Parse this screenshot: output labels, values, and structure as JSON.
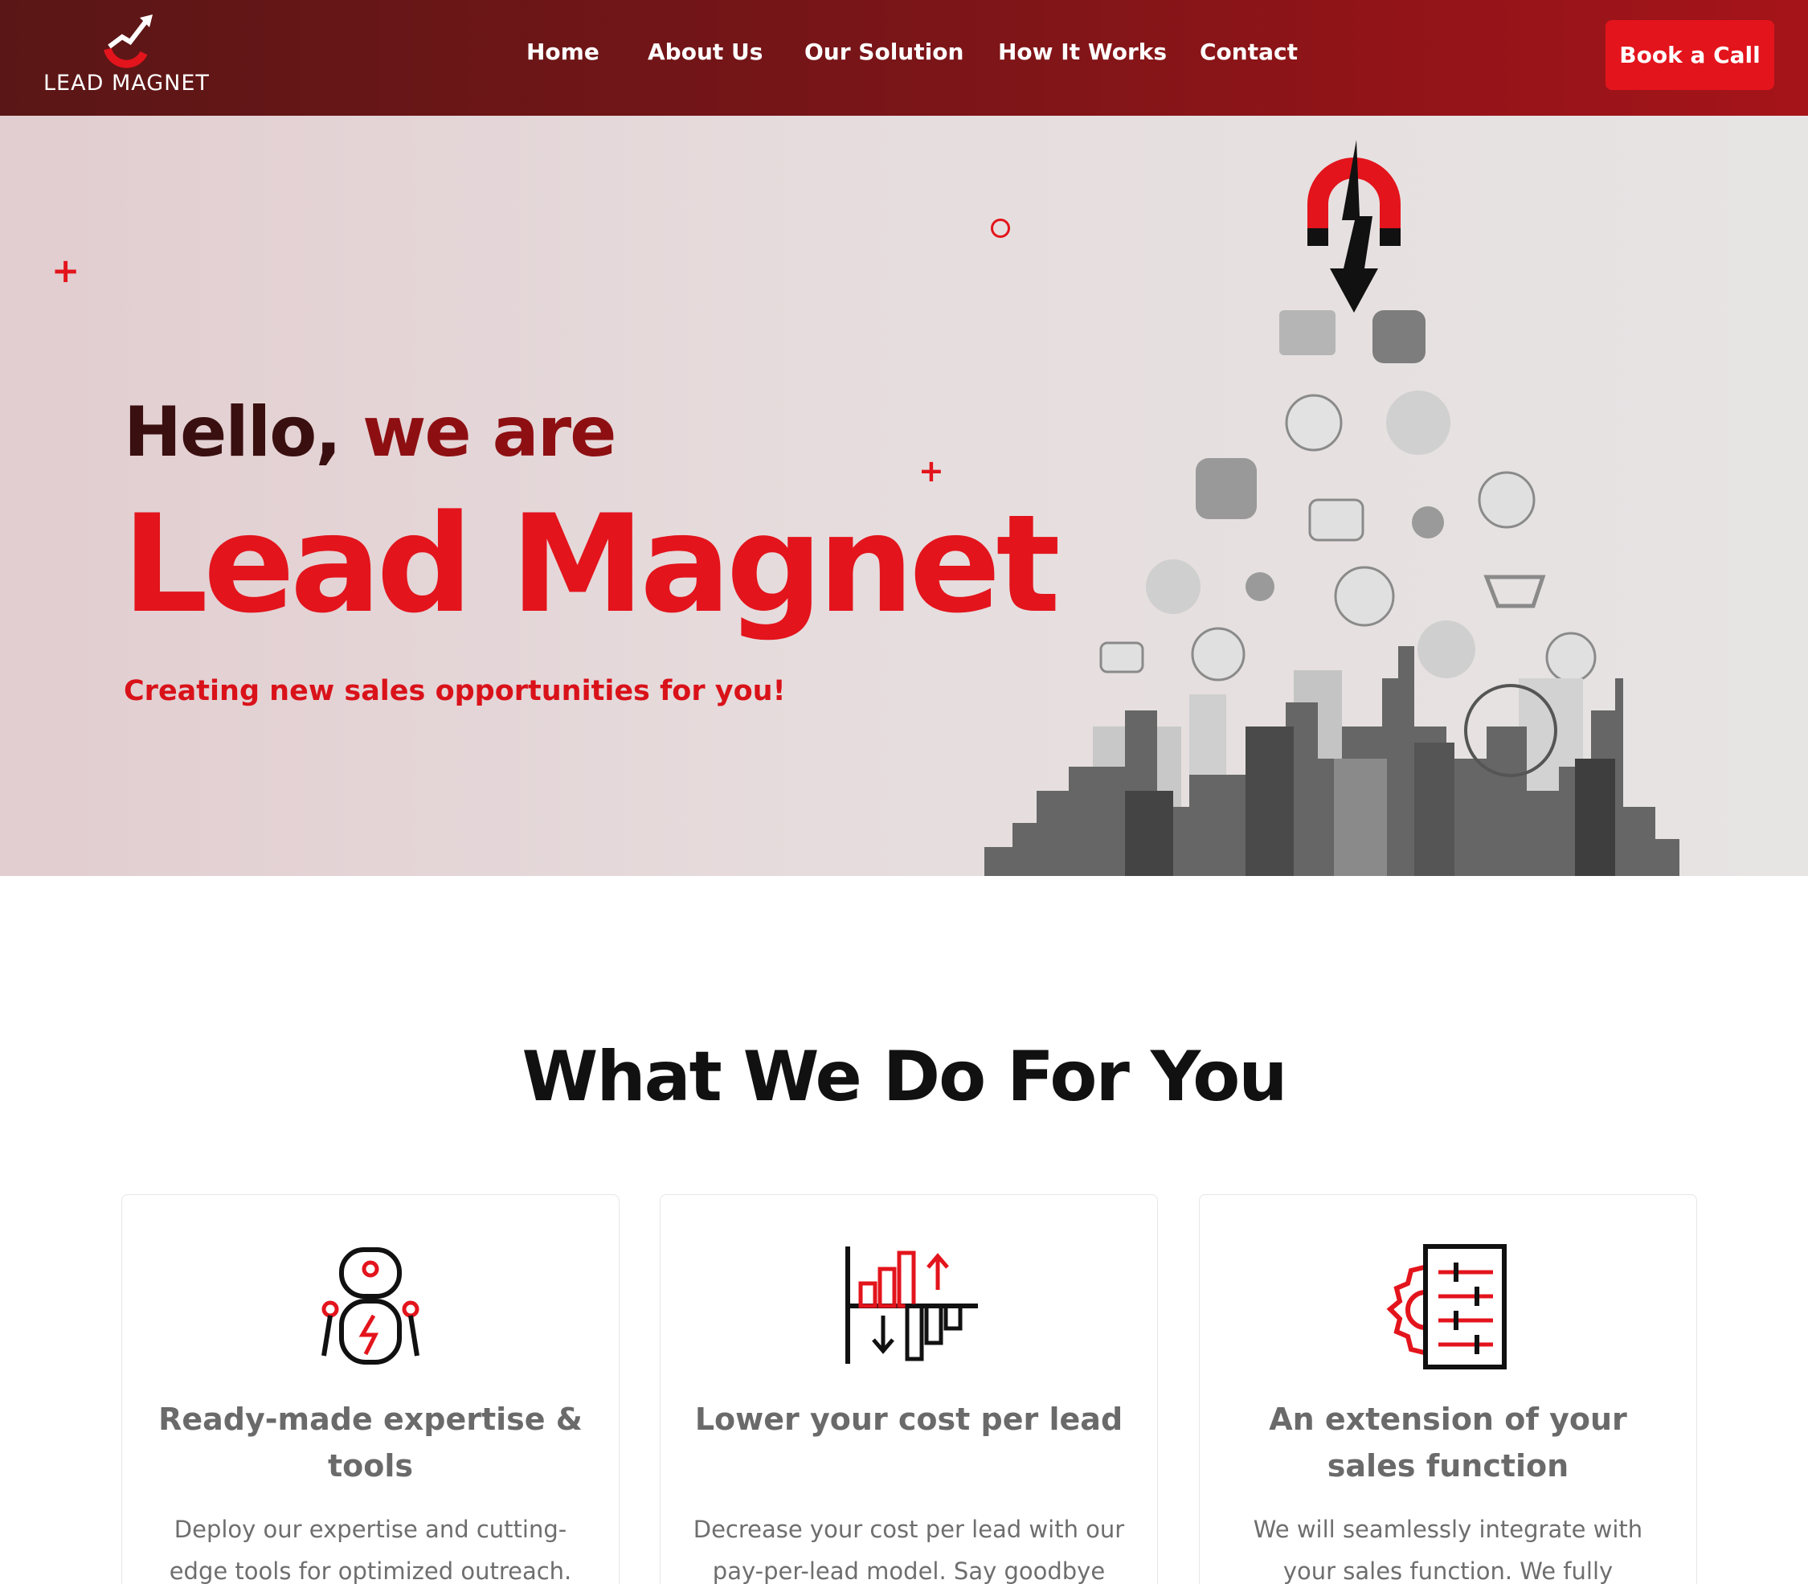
{
  "header": {
    "logo_text": "LEAD MAGNET",
    "nav": [
      "Home",
      "About Us",
      "Our Solution",
      "How It Works",
      "Contact"
    ],
    "cta_label": "Book a Call"
  },
  "hero": {
    "greeting_part1": "Hello,",
    "greeting_part2": "we are",
    "title": "Lead Magnet",
    "subtitle": "Creating new sales opportunities for you!"
  },
  "services": {
    "title": "What We Do For You",
    "cards": [
      {
        "icon": "robot-icon",
        "title": "Ready-made expertise & tools",
        "text": "Deploy our expertise and cutting-edge tools for optimized outreach."
      },
      {
        "icon": "cost-chart-icon",
        "title": "Lower your cost per lead",
        "text": "Decrease your cost per lead with our pay-per-lead model. Say goodbye"
      },
      {
        "icon": "gear-settings-icon",
        "title": "An extension of your sales function",
        "text": "We will seamlessly integrate with your sales function. We fully"
      }
    ]
  },
  "colors": {
    "brand_red": "#e3141c",
    "dark_red": "#5a1616",
    "hero_bg": "#e6dcdd"
  }
}
